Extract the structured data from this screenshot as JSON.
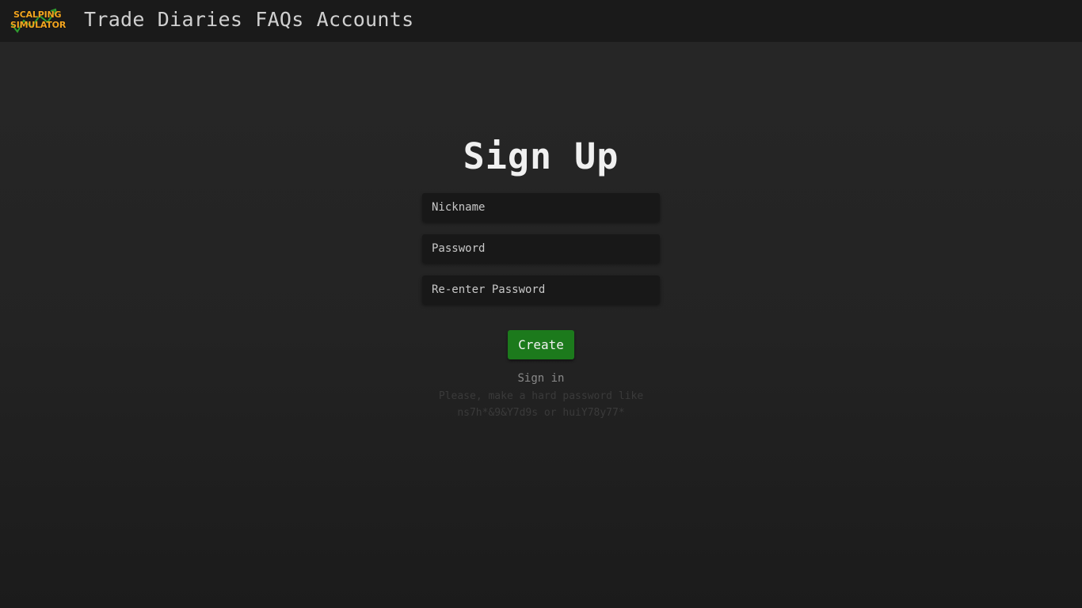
{
  "logo": {
    "line1": "SCALPING",
    "line2": "SIMULATOR",
    "icon": "chart-arrow-icon",
    "colors": {
      "text": "#f3a51f",
      "arrow": "#2f9e2f"
    }
  },
  "nav": {
    "items": [
      {
        "label": "Trade"
      },
      {
        "label": "Diaries"
      },
      {
        "label": "FAQs"
      },
      {
        "label": "Accounts"
      }
    ]
  },
  "form": {
    "title": "Sign Up",
    "nickname_placeholder": "Nickname",
    "password_placeholder": "Password",
    "reenter_placeholder": "Re-enter Password",
    "create_label": "Create",
    "signin_label": "Sign in",
    "hint_line1": "Please, make a hard password like",
    "hint_line2": "ns7h*&9&Y7d9s or huiY78y77*"
  },
  "colors": {
    "background": "#262626",
    "topbar": "#1a1a1a",
    "button": "#1c7a1c",
    "field": "#181818"
  }
}
